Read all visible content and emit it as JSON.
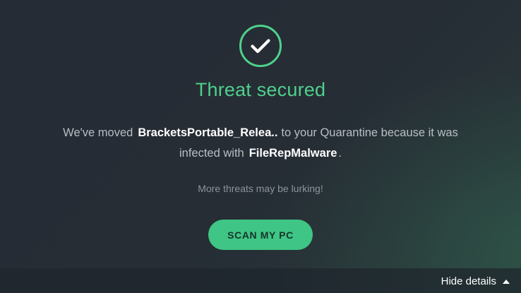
{
  "status": {
    "icon": "check-circle-icon",
    "title": "Threat secured",
    "color": "#4fd08c"
  },
  "message": {
    "part1": "We've moved",
    "file_name": "BracketsPortable_Relea..",
    "part2": "to your Quarantine because it was",
    "part3": "infected with",
    "threat_name": "FileRepMalware",
    "part4": "."
  },
  "lurking_text": "More threats may be lurking!",
  "scan_button": {
    "label": "SCAN MY PC",
    "color": "#3fc585"
  },
  "footer": {
    "hide_details_label": "Hide details",
    "icon": "caret-up-icon"
  }
}
